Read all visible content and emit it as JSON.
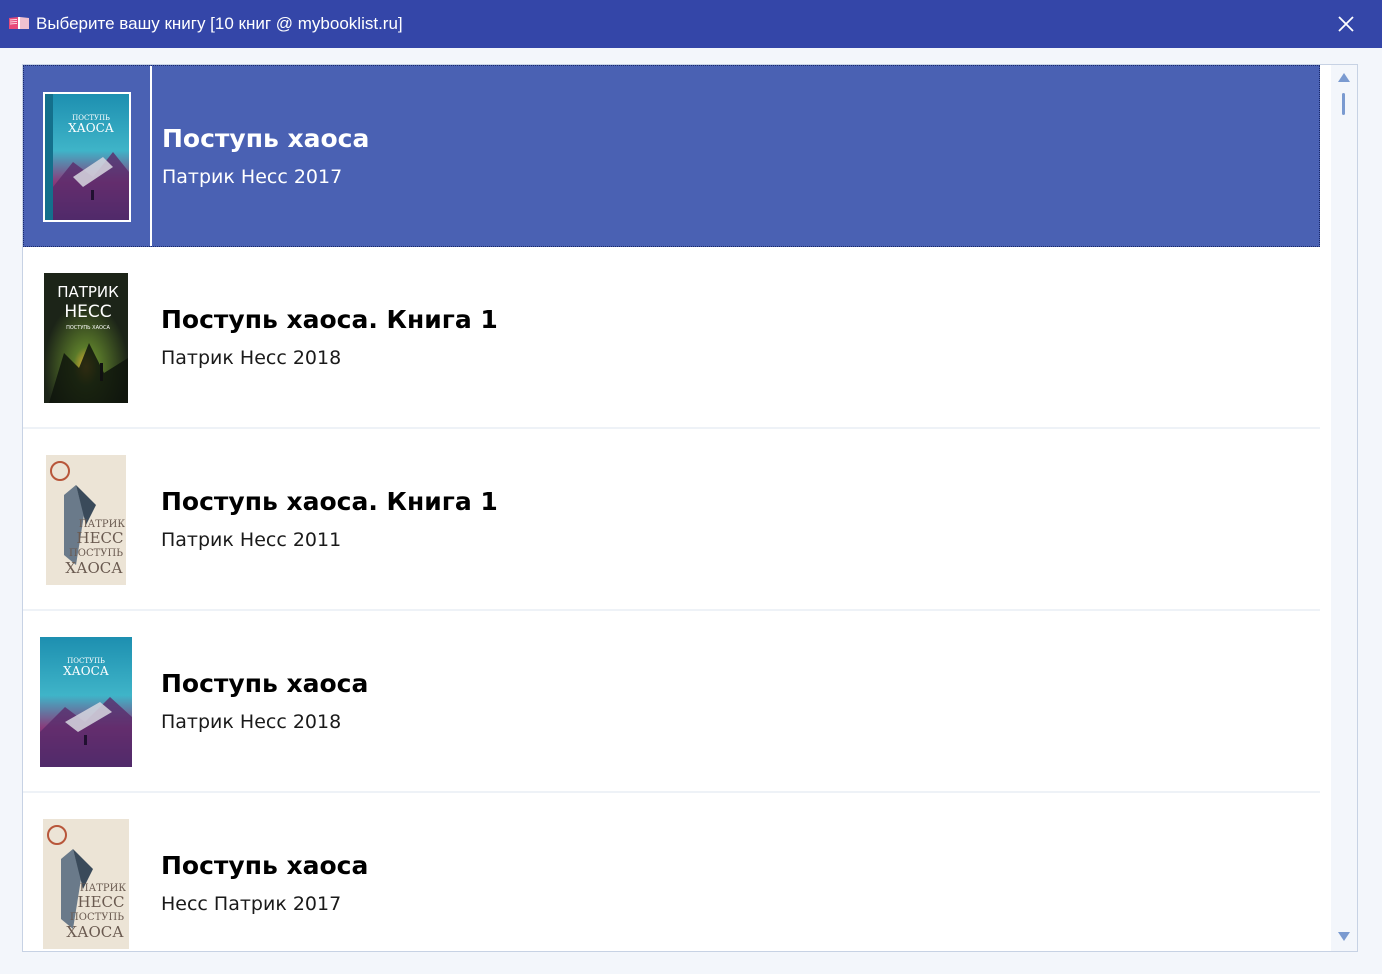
{
  "window": {
    "title": "Выберите вашу книгу [10 книг @ mybooklist.ru]",
    "app_icon": "open-book-icon",
    "close_icon": "close-icon"
  },
  "books": [
    {
      "title": "Поступь хаоса",
      "meta": "Патрик Несс 2017",
      "selected": true
    },
    {
      "title": "Поступь хаоса. Книга 1",
      "meta": "Патрик Несс 2018",
      "selected": false
    },
    {
      "title": "Поступь хаоса. Книга 1",
      "meta": "Патрик Несс 2011",
      "selected": false
    },
    {
      "title": "Поступь хаоса",
      "meta": "Патрик Несс 2018",
      "selected": false
    },
    {
      "title": "Поступь хаоса",
      "meta": "Несс Патрик 2017",
      "selected": false
    }
  ],
  "cover_text": {
    "cover_a": [
      "ПОСТУПЬ",
      "ХАОСА"
    ],
    "cover_b": [
      "ПАТРИК",
      "НЕСС",
      "ПОСТУПЬ ХАОСА"
    ],
    "cover_c": [
      "ПАТРИК",
      "НЕСС",
      "ПОСТУПЬ",
      "ХАОСА"
    ]
  },
  "colors": {
    "titlebar": "#3446a8",
    "selection": "#4a61b3",
    "scrollbar_arrow": "#7a9ad0"
  },
  "scrollbar": {
    "up_icon": "arrow-up-icon",
    "down_icon": "arrow-down-icon"
  }
}
